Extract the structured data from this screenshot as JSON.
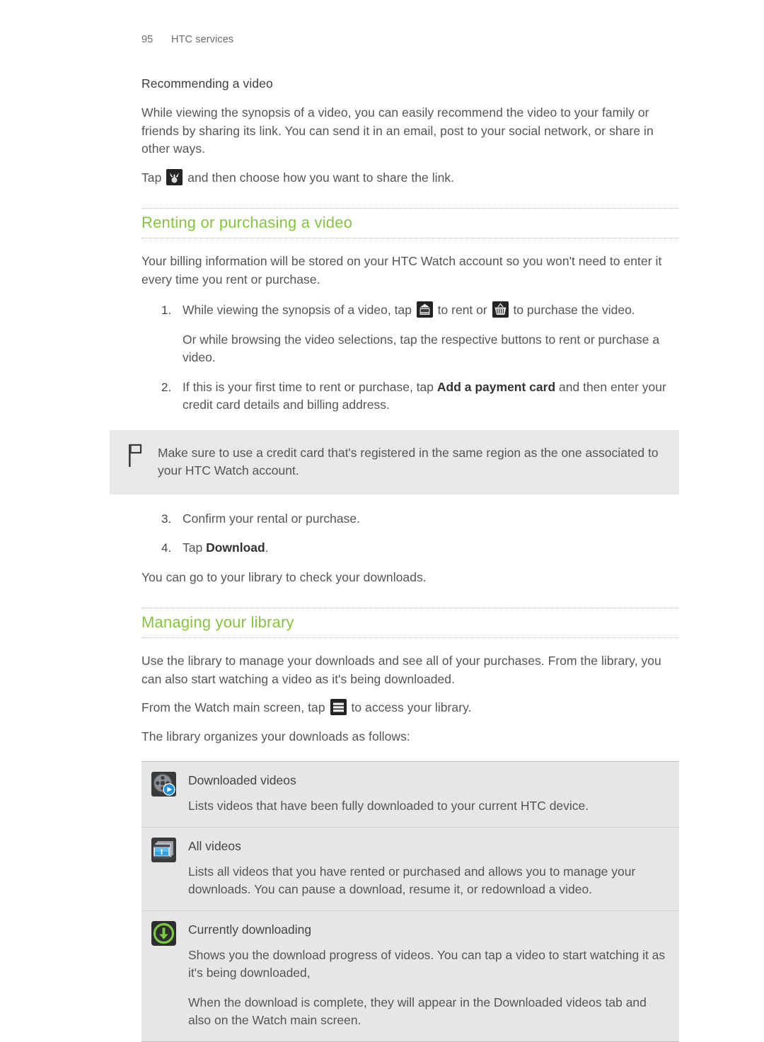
{
  "header": {
    "page_number": "95",
    "chapter": "HTC services"
  },
  "colors": {
    "heading_green": "#86c440",
    "body_text": "#555555",
    "note_background": "#e8e8e8",
    "panel_background": "#e6e6e6",
    "icon_dark": "#242424",
    "download_green": "#7ac943",
    "play_blue": "#1f8fd6"
  },
  "recommending": {
    "subheading": "Recommending a video",
    "paragraph1": "While viewing the synopsis of a video, you can easily recommend the video to your family or friends by sharing its link. You can send it in an email, post to your social network, or share in other ways.",
    "tap_prefix": "Tap",
    "share_icon_name": "share-icon",
    "tap_suffix": "and then choose how you want to share the link."
  },
  "renting": {
    "heading": "Renting or purchasing a video",
    "intro": "Your billing information will be stored on your HTC Watch account so you won't need to enter it every time you rent or purchase.",
    "step1_part1": "While viewing the synopsis of a video, tap",
    "step1_rent_icon_name": "rent-ticket-icon",
    "step1_part2": "to rent or",
    "step1_purchase_icon_name": "shopping-basket-icon",
    "step1_part3": "to purchase the video.",
    "step1_extra": "Or while browsing the video selections, tap the respective buttons to rent or purchase a video.",
    "step2_part1": "If this is your first time to rent or purchase, tap",
    "step2_bold": "Add a payment card",
    "step2_part2": "and then enter your credit card details and billing address.",
    "note_icon_name": "flag-icon",
    "note_text": "Make sure to use a credit card that's registered in the same region as the one associated to your HTC Watch account.",
    "step3": "Confirm your rental or purchase.",
    "step4_prefix": "Tap",
    "step4_bold": "Download",
    "step4_suffix": ".",
    "closing": "You can go to your library to check your downloads."
  },
  "managing": {
    "heading": "Managing your library",
    "paragraph1": "Use the library to manage your downloads and see all of your purchases. From the library, you can also start watching a video as it's being downloaded.",
    "tap_prefix": "From the Watch main screen, tap",
    "menu_icon_name": "hamburger-menu-icon",
    "tap_suffix": "to access your library.",
    "paragraph2": "The library organizes your downloads as follows:",
    "items": [
      {
        "icon": "film-reel-play-icon",
        "title": "Downloaded videos",
        "descriptions": [
          "Lists videos that have been fully downloaded to your current HTC device."
        ]
      },
      {
        "icon": "video-stack-icon",
        "title": "All videos",
        "descriptions": [
          "Lists all videos that you have rented or purchased and allows you to manage your downloads. You can pause a download, resume it, or redownload a video."
        ]
      },
      {
        "icon": "download-arrow-icon",
        "title": "Currently downloading",
        "descriptions": [
          "Shows you the download progress of videos. You can tap a video to start watching it as it's being downloaded,",
          "When the download is complete, they will appear in the Downloaded videos tab and also on the Watch main screen."
        ]
      }
    ]
  }
}
